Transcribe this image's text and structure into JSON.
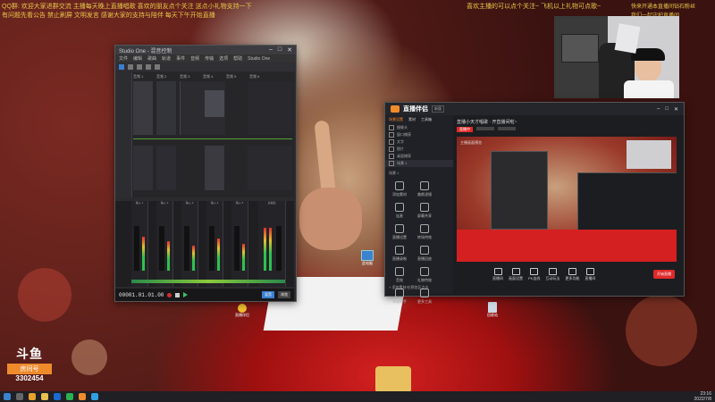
{
  "overlay": {
    "top_left_line_1": "QQ群: 欢迎大家进群交流  主播每天晚上直播唱歌  喜欢的朋友点个关注  送点小礼物支持一下",
    "top_left_line_2": "有问题先看公告  禁止刷屏  文明发言  感谢大家的支持与陪伴  每天下午开始直播",
    "top_right_line_1": "喜欢主播的可以点个关注~  飞机以上礼物可点歌~",
    "top_right_line_2": "快来开通本直播间钻石粉丝",
    "top_right_line_3": "我们一起守护直播间"
  },
  "platform": {
    "logo_text": "斗鱼",
    "room_badge": "房间号",
    "room_number": "3302454"
  },
  "daw": {
    "title": "Studio One - 混音控制",
    "menu": [
      "文件",
      "编辑",
      "歌曲",
      "轨道",
      "事件",
      "音频",
      "传输",
      "选项",
      "帮助",
      "Studio One"
    ],
    "time_display": "00001.01.01.00",
    "footer_buttons": [
      "混音",
      "浏览"
    ],
    "track_names": [
      "音频 1",
      "音频 2",
      "音频 3",
      "音频 4",
      "音频 5",
      "音频 6"
    ],
    "channel_labels": [
      "输入 1",
      "输入 2",
      "输入 3",
      "输入 4",
      "输入 5",
      "主输出"
    ]
  },
  "live": {
    "app_title": "直播伴侣",
    "tag": "新版",
    "tabs": [
      "场景设置",
      "素材",
      "工具箱"
    ],
    "scene_header": "场景 1",
    "sources": [
      "摄像头",
      "窗口捕获",
      "文字",
      "图片",
      "桌面捕获",
      "场景 1"
    ],
    "add_scene": "+ 添加场景",
    "room_title": "直播小天才唱歌 · 开直播间啦~",
    "preview_label": "主播画面预览",
    "toolbar": [
      "直播间",
      "画面设置",
      "PK连线",
      "互动玩法",
      "更多功能",
      "直播间"
    ],
    "side_tools": [
      "添加素材",
      "美颜滤镜",
      "连麦",
      "屏幕共享",
      "直播设置",
      "转场特效",
      "直播录制",
      "直播回放",
      "音效",
      "礼物特效",
      "弹幕助手",
      "更多工具"
    ],
    "bottom_hint": "+ 添加素材/在预览区点击",
    "start_button": "开始直播",
    "live_status": "直播中"
  },
  "desktop": {
    "icon1_label": "此电脑",
    "icon2_label": "回收站",
    "icon3_label": "直播伴侣"
  },
  "taskbar": {
    "time": "23:16",
    "date": "2022/7/8"
  },
  "colors": {
    "accent_orange": "#f08b2c",
    "live_red": "#e02a2a",
    "meter_green": "#30c050",
    "overlay_yellow": "#e8c64a"
  }
}
